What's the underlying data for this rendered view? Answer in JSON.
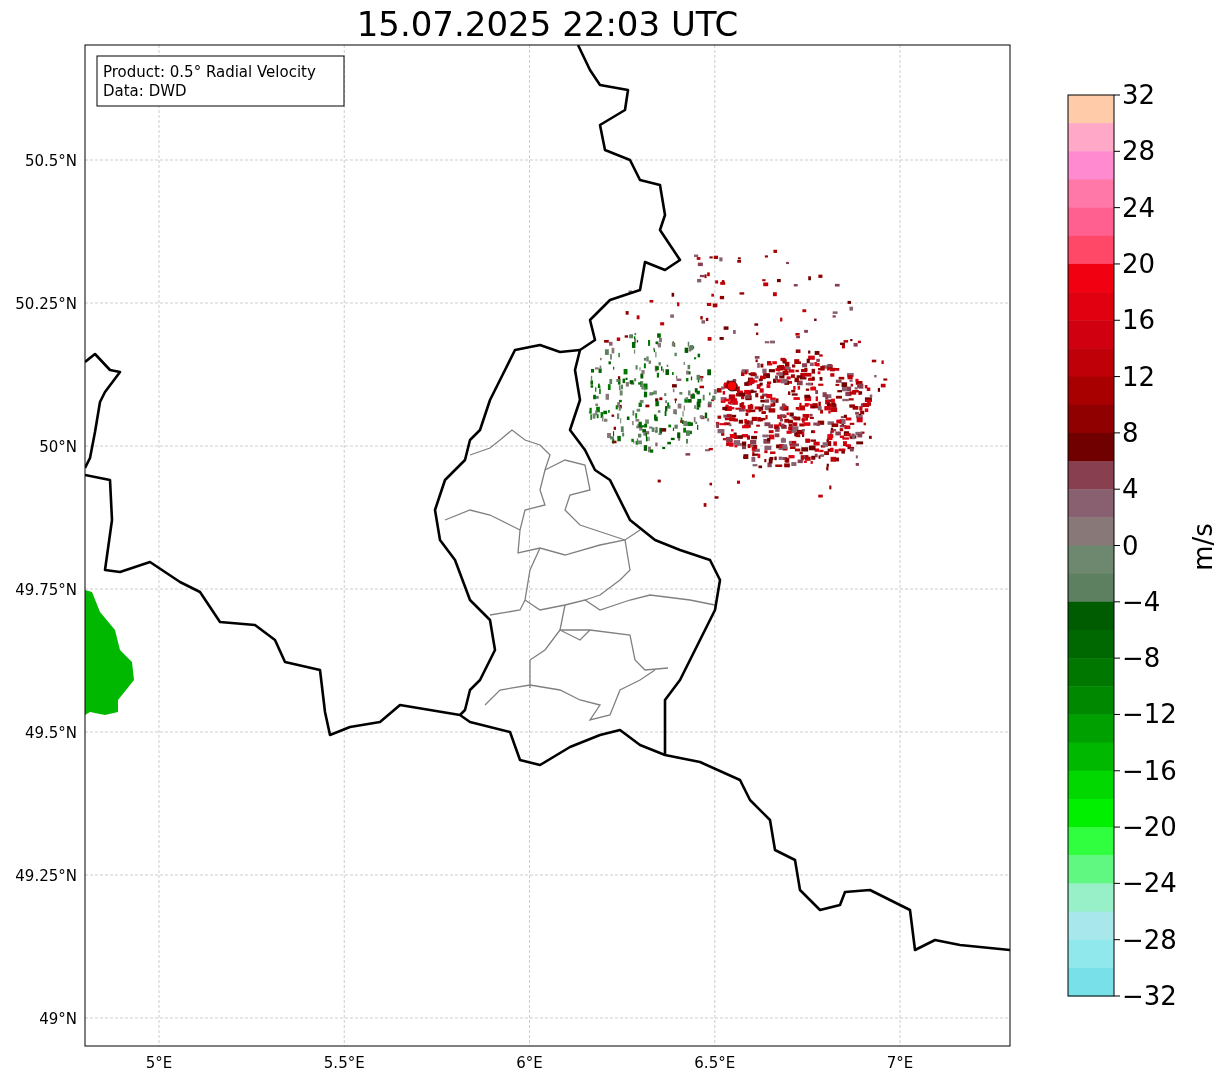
{
  "title": "15.07.2025 22:03 UTC",
  "map": {
    "info_box": [
      "Product: 0.5° Radial Velocity",
      "Data: DWD"
    ],
    "xticks": [
      "5°E",
      "5.5°E",
      "6°E",
      "6.5°E",
      "7°E"
    ],
    "yticks": [
      "50.5°N",
      "50.25°N",
      "50°N",
      "49.75°N",
      "49.5°N",
      "49.25°N",
      "49°N"
    ]
  },
  "colorbar": {
    "label": "m/s",
    "ticks": [
      "32",
      "28",
      "24",
      "20",
      "16",
      "12",
      "8",
      "4",
      "0",
      "−4",
      "−8",
      "−12",
      "−16",
      "−20",
      "−24",
      "−28",
      "−32"
    ],
    "bins": [
      {
        "color": "#ffcba8"
      },
      {
        "color": "#ffa8c8"
      },
      {
        "color": "#ff8ad0"
      },
      {
        "color": "#ff78a8"
      },
      {
        "color": "#ff6090"
      },
      {
        "color": "#ff4868"
      },
      {
        "color": "#f00010"
      },
      {
        "color": "#e00010"
      },
      {
        "color": "#d00010"
      },
      {
        "color": "#c00008"
      },
      {
        "color": "#a80000"
      },
      {
        "color": "#900000"
      },
      {
        "color": "#700000"
      },
      {
        "color": "#884050"
      },
      {
        "color": "#886070"
      },
      {
        "color": "#887878"
      },
      {
        "color": "#6e8870"
      },
      {
        "color": "#5c8060"
      },
      {
        "color": "#005c00"
      },
      {
        "color": "#006800"
      },
      {
        "color": "#007800"
      },
      {
        "color": "#008800"
      },
      {
        "color": "#00a000"
      },
      {
        "color": "#00b800"
      },
      {
        "color": "#00d800"
      },
      {
        "color": "#00f000"
      },
      {
        "color": "#30ff40"
      },
      {
        "color": "#60f880"
      },
      {
        "color": "#98f0c8"
      },
      {
        "color": "#a8e8ec"
      },
      {
        "color": "#90e8ec"
      },
      {
        "color": "#78e0e8"
      }
    ]
  }
}
